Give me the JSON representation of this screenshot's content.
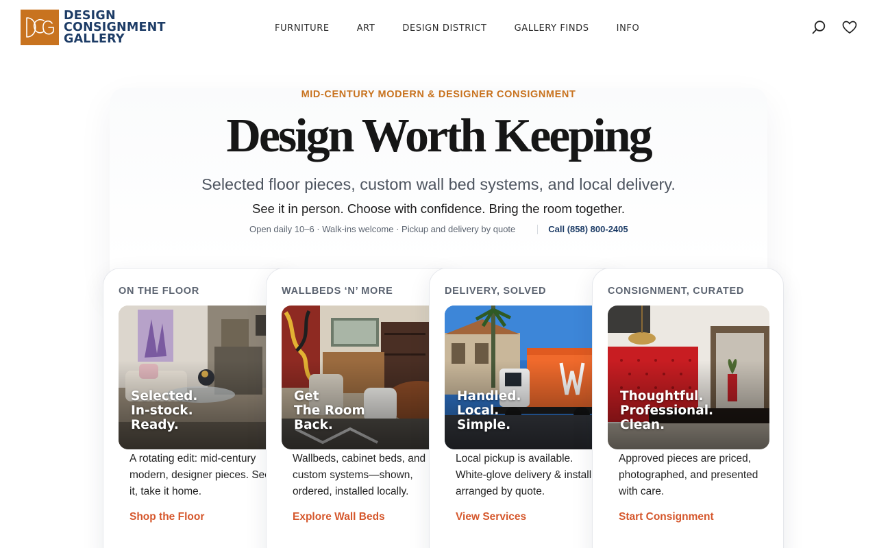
{
  "brand": {
    "logo_monogram": "DCG",
    "name_lines": [
      "DESIGN",
      "CONSIGNMENT",
      "GALLERY"
    ],
    "accent_color": "#c8731f",
    "navy_color": "#1d3c66",
    "link_color": "#d5572c"
  },
  "nav": {
    "items": [
      "FURNITURE",
      "ART",
      "DESIGN DISTRICT",
      "GALLERY FINDS",
      "INFO"
    ],
    "icons": [
      "search-icon",
      "heart-icon"
    ]
  },
  "hero": {
    "eyebrow": "MID-CENTURY MODERN & DESIGNER CONSIGNMENT",
    "headline": "Design Worth Keeping",
    "subhead": "Selected floor pieces, custom wall bed systems, and local delivery.",
    "tagline": "See it in person. Choose with confidence. Bring the room together.",
    "hours": "Open daily 10–6 · Walk-ins welcome · Pickup and delivery by quote",
    "phone": "Call (858) 800-2405"
  },
  "cards": [
    {
      "label": "ON THE FLOOR",
      "overlay": [
        "Selected.",
        "In-stock.",
        "Ready."
      ],
      "description": "A rotating edit: mid-century modern, designer pieces. See it, take it home.",
      "link": "Shop the Floor"
    },
    {
      "label": "WALLBEDS ‘N’ MORE",
      "overlay": [
        "Get",
        "The Room",
        "Back."
      ],
      "description": "Wallbeds, cabinet beds, and custom systems—shown, ordered, installed locally.",
      "link": "Explore Wall Beds"
    },
    {
      "label": "DELIVERY, SOLVED",
      "overlay": [
        "Handled.",
        "Local.",
        "Simple."
      ],
      "description": "Local pickup is available. White-glove delivery & install arranged by quote.",
      "link": "View Services"
    },
    {
      "label": "CONSIGNMENT, CURATED",
      "overlay": [
        "Thoughtful.",
        "Professional.",
        "Clean."
      ],
      "description": "Approved pieces are priced, photographed, and presented with care.",
      "link": "Start Consignment"
    }
  ]
}
